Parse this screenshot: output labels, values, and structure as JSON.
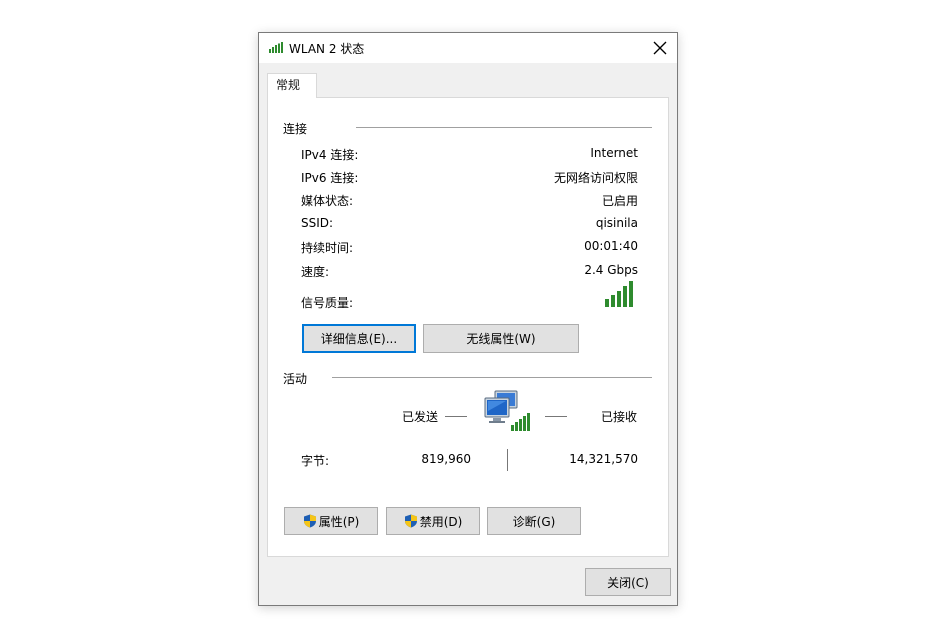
{
  "window": {
    "title": "WLAN 2 状态",
    "icons": {
      "title": "wifi-signal-icon",
      "close": "close-icon"
    }
  },
  "tabs": [
    {
      "label": "常规",
      "selected": true
    }
  ],
  "connection": {
    "section_title": "连接",
    "rows": [
      {
        "label": "IPv4 连接:",
        "value": "Internet"
      },
      {
        "label": "IPv6 连接:",
        "value": "无网络访问权限"
      },
      {
        "label": "媒体状态:",
        "value": "已启用"
      },
      {
        "label": "SSID:",
        "value": "qisinila"
      },
      {
        "label": "持续时间:",
        "value": "00:01:40"
      },
      {
        "label": "速度:",
        "value": "2.4 Gbps"
      }
    ],
    "signal": {
      "label": "信号质量:",
      "bars_filled": 5,
      "bars_total": 5
    },
    "buttons": {
      "details": "详细信息(E)...",
      "wireless_props": "无线属性(W)"
    }
  },
  "activity": {
    "section_title": "活动",
    "sent_label": "已发送",
    "received_label": "已接收",
    "bytes_label": "字节:",
    "bytes_sent": "819,960",
    "bytes_received": "14,321,570"
  },
  "bottom_buttons": {
    "properties": "属性(P)",
    "disable": "禁用(D)",
    "diagnose": "诊断(G)"
  },
  "footer": {
    "close": "关闭(C)"
  },
  "colors": {
    "signal_green": "#2e8b2e",
    "focus_blue": "#0078d7",
    "shield_blue": "#1e5fb4",
    "shield_yellow": "#f5c518"
  }
}
